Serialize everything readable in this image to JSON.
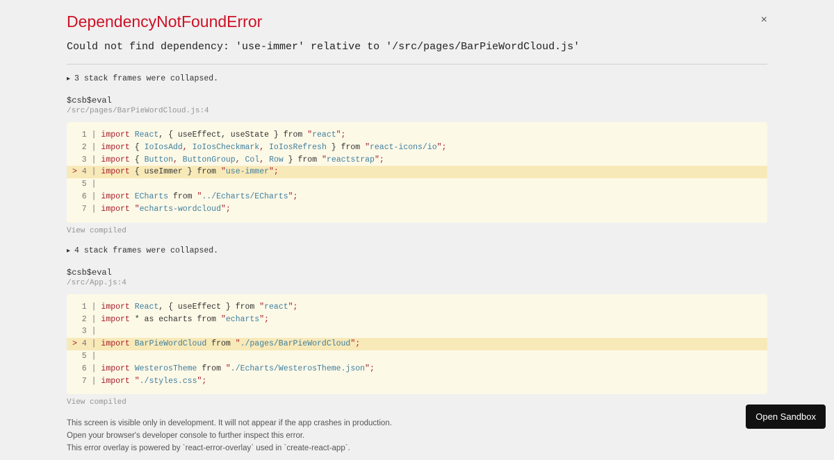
{
  "error": {
    "title": "DependencyNotFoundError",
    "message": "Could not find dependency: 'use-immer' relative to '/src/pages/BarPieWordCloud.js'"
  },
  "close_label": "×",
  "collapse1": "3 stack frames were collapsed.",
  "collapse2": "4 stack frames were collapsed.",
  "frame1": {
    "fn": "$csb$eval",
    "loc": "/src/pages/BarPieWordCloud.js:4",
    "lines": {
      "l1": {
        "num": "  1 | ",
        "kw": "import",
        "id": " React",
        "rest": ", { useEffect, useState } ",
        "from": "from ",
        "q1": "\"",
        "str": "react",
        "q2": "\"",
        "end": ";"
      },
      "l2": {
        "num": "  2 | ",
        "kw": "import",
        "rest": " { ",
        "id1": "IoIosAdd",
        "c1": ", ",
        "id2": "IoIosCheckmark",
        "c2": ", ",
        "id3": "IoIosRefresh",
        "rest2": " } ",
        "from": "from ",
        "q1": "\"",
        "str": "react-icons/io",
        "q2": "\"",
        "end": ";"
      },
      "l3": {
        "num": "  3 | ",
        "kw": "import",
        "rest": " { ",
        "id1": "Button",
        "c1": ", ",
        "id2": "ButtonGroup",
        "c2": ", ",
        "id3": "Col",
        "c3": ", ",
        "id4": "Row",
        "rest2": " } ",
        "from": "from ",
        "q1": "\"",
        "str": "reactstrap",
        "q2": "\"",
        "end": ";"
      },
      "l4": {
        "caret": "> ",
        "num": "4 | ",
        "kw": "import",
        "rest": " { useImmer } ",
        "from": "from ",
        "q1": "\"",
        "str": "use-immer",
        "q2": "\"",
        "end": ";"
      },
      "l5": {
        "num": "  5 | "
      },
      "l6": {
        "num": "  6 | ",
        "kw": "import",
        "id": " ECharts",
        "rest": " ",
        "from": "from ",
        "q1": "\"",
        "str": "../Echarts/ECharts",
        "q2": "\"",
        "end": ";"
      },
      "l7": {
        "num": "  7 | ",
        "kw": "import",
        "rest": " ",
        "q1": "\"",
        "str": "echarts-wordcloud",
        "q2": "\"",
        "end": ";"
      }
    }
  },
  "frame2": {
    "fn": "$csb$eval",
    "loc": "/src/App.js:4",
    "lines": {
      "l1": {
        "num": "  1 | ",
        "kw": "import",
        "id": " React",
        "rest": ", { useEffect } ",
        "from": "from ",
        "q1": "\"",
        "str": "react",
        "q2": "\"",
        "end": ";"
      },
      "l2": {
        "num": "  2 | ",
        "kw": "import",
        "rest": " * as echarts ",
        "from": "from ",
        "q1": "\"",
        "str": "echarts",
        "q2": "\"",
        "end": ";"
      },
      "l3": {
        "num": "  3 | "
      },
      "l4": {
        "caret": "> ",
        "num": "4 | ",
        "kw": "import",
        "id": " BarPieWordCloud",
        "rest": " ",
        "from": "from ",
        "q1": "\"",
        "str": "./pages/BarPieWordCloud",
        "q2": "\"",
        "end": ";"
      },
      "l5": {
        "num": "  5 | "
      },
      "l6": {
        "num": "  6 | ",
        "kw": "import",
        "id": " WesterosTheme",
        "rest": " ",
        "from": "from ",
        "q1": "\"",
        "str": "./Echarts/WesterosTheme.json",
        "q2": "\"",
        "end": ";"
      },
      "l7": {
        "num": "  7 | ",
        "kw": "import",
        "rest": " ",
        "q1": "\"",
        "str": "./styles.css",
        "q2": "\"",
        "end": ";"
      }
    }
  },
  "view_compiled": "View compiled",
  "footer": {
    "l1": "This screen is visible only in development. It will not appear if the app crashes in production.",
    "l2": "Open your browser's developer console to further inspect this error.",
    "l3": "This error overlay is powered by `react-error-overlay` used in `create-react-app`."
  },
  "sandbox_btn": "Open Sandbox"
}
